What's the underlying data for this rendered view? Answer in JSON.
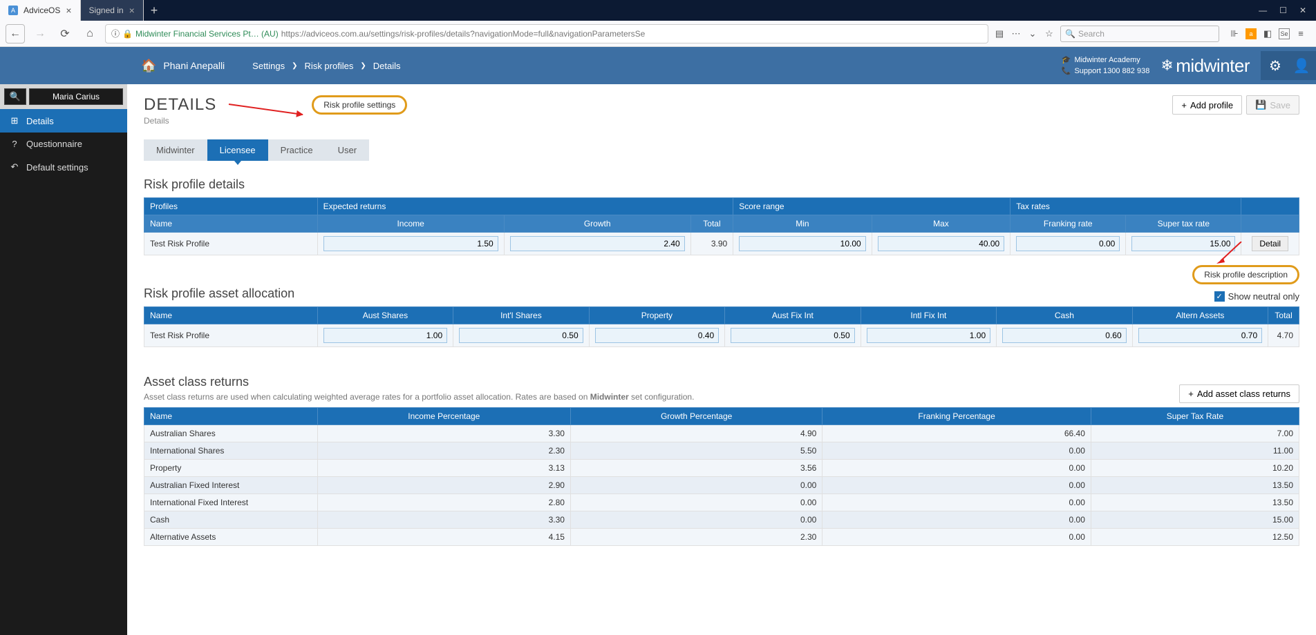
{
  "browser": {
    "tab1_title": "AdviceOS",
    "tab2_title": "Signed in",
    "url_site": "Midwinter Financial Services Pt…  (AU)",
    "url_path": "https://adviceos.com.au/settings/risk-profiles/details?navigationMode=full&navigationParametersSe",
    "search_placeholder": "Search"
  },
  "header": {
    "user": "Phani Anepalli",
    "breadcrumb": [
      "Settings",
      "Risk profiles",
      "Details"
    ],
    "academy": "Midwinter Academy",
    "support": "Support 1300 882 938",
    "logo": "midwinter"
  },
  "sidebar": {
    "selected_client": "Maria Carius",
    "items": [
      {
        "icon": "⊞",
        "label": "Details"
      },
      {
        "icon": "?",
        "label": "Questionnaire"
      },
      {
        "icon": "↶",
        "label": "Default settings"
      }
    ]
  },
  "page": {
    "title": "DETAILS",
    "subtitle": "Details",
    "add_profile": "Add profile",
    "save": "Save",
    "callout1": "Risk profile settings",
    "callout2": "Risk profile description"
  },
  "tabs": [
    "Midwinter",
    "Licensee",
    "Practice",
    "User"
  ],
  "rpd": {
    "title": "Risk profile details",
    "groups": [
      "Profiles",
      "Expected returns",
      "Score range",
      "Tax rates"
    ],
    "cols": [
      "Name",
      "Income",
      "Growth",
      "Total",
      "Min",
      "Max",
      "Franking rate",
      "Super tax rate"
    ],
    "row": {
      "name": "Test Risk Profile",
      "income": "1.50",
      "growth": "2.40",
      "total": "3.90",
      "min": "10.00",
      "max": "40.00",
      "franking": "0.00",
      "supertax": "15.00",
      "detail": "Detail"
    }
  },
  "alloc": {
    "title": "Risk profile asset allocation",
    "neutral": "Show neutral only",
    "cols": [
      "Name",
      "Aust Shares",
      "Int'l Shares",
      "Property",
      "Aust Fix Int",
      "Intl Fix Int",
      "Cash",
      "Altern Assets",
      "Total"
    ],
    "row": {
      "name": "Test Risk Profile",
      "vals": [
        "1.00",
        "0.50",
        "0.40",
        "0.50",
        "1.00",
        "0.60",
        "0.70"
      ],
      "total": "4.70"
    }
  },
  "acr": {
    "title": "Asset class returns",
    "add": "Add asset class returns",
    "desc_pre": "Asset class returns are used when calculating weighted average rates for a portfolio asset allocation. Rates are based on ",
    "desc_bold": "Midwinter",
    "desc_post": " set configuration.",
    "cols": [
      "Name",
      "Income Percentage",
      "Growth Percentage",
      "Franking Percentage",
      "Super Tax Rate"
    ],
    "rows": [
      {
        "name": "Australian Shares",
        "income": "3.30",
        "growth": "4.90",
        "franking": "66.40",
        "super": "7.00"
      },
      {
        "name": "International Shares",
        "income": "2.30",
        "growth": "5.50",
        "franking": "0.00",
        "super": "11.00"
      },
      {
        "name": "Property",
        "income": "3.13",
        "growth": "3.56",
        "franking": "0.00",
        "super": "10.20"
      },
      {
        "name": "Australian Fixed Interest",
        "income": "2.90",
        "growth": "0.00",
        "franking": "0.00",
        "super": "13.50"
      },
      {
        "name": "International Fixed Interest",
        "income": "2.80",
        "growth": "0.00",
        "franking": "0.00",
        "super": "13.50"
      },
      {
        "name": "Cash",
        "income": "3.30",
        "growth": "0.00",
        "franking": "0.00",
        "super": "15.00"
      },
      {
        "name": "Alternative Assets",
        "income": "4.15",
        "growth": "2.30",
        "franking": "0.00",
        "super": "12.50"
      }
    ]
  }
}
